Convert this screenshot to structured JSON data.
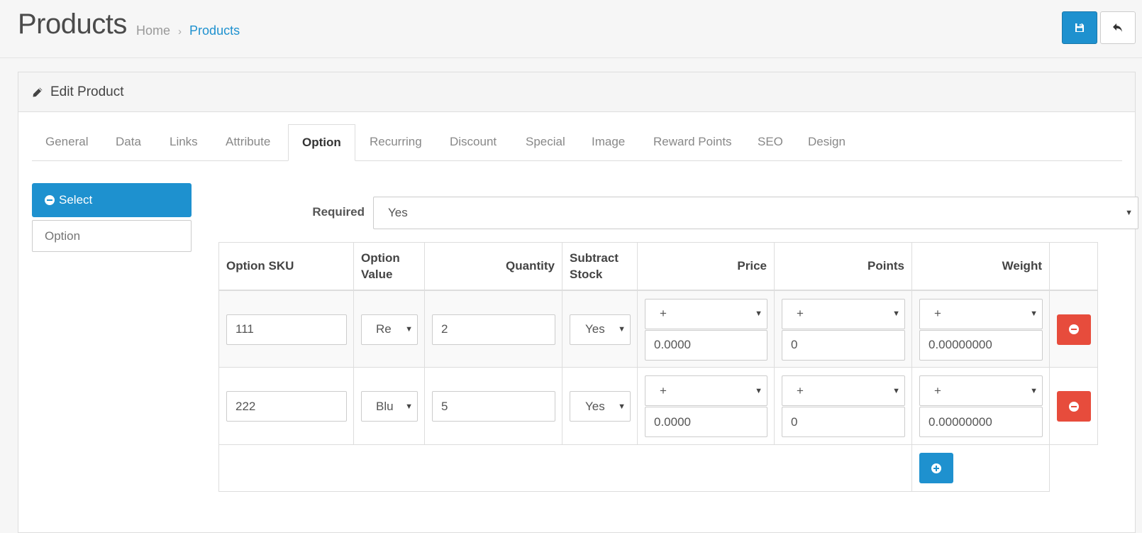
{
  "header": {
    "title": "Products",
    "breadcrumb": [
      {
        "label": "Home"
      },
      {
        "label": "Products"
      }
    ],
    "breadcrumb_separator": "›",
    "save_icon": "floppy-disk-icon",
    "back_icon": "reply-icon"
  },
  "panel": {
    "title": "Edit Product",
    "title_icon": "pencil-icon"
  },
  "tabs": [
    {
      "label": "General"
    },
    {
      "label": "Data"
    },
    {
      "label": "Links"
    },
    {
      "label": "Attribute"
    },
    {
      "label": "Option",
      "active": true
    },
    {
      "label": "Recurring"
    },
    {
      "label": "Discount"
    },
    {
      "label": "Special"
    },
    {
      "label": "Image"
    },
    {
      "label": "Reward Points"
    },
    {
      "label": "SEO"
    },
    {
      "label": "Design"
    }
  ],
  "option_sidebar": {
    "selected_option": "Select",
    "option_input_placeholder": "Option"
  },
  "required": {
    "label": "Required",
    "value": "Yes"
  },
  "table": {
    "headers": {
      "sku": "Option SKU",
      "value_line1": "Option",
      "value_line2": "Value",
      "quantity": "Quantity",
      "subtract_line1": "Subtract",
      "subtract_line2": "Stock",
      "price": "Price",
      "points": "Points",
      "weight": "Weight"
    },
    "rows": [
      {
        "sku": "111",
        "option_value": "Re",
        "quantity": "2",
        "subtract": "Yes",
        "price_prefix": "+",
        "price": "0.0000",
        "points_prefix": "+",
        "points": "0",
        "weight_prefix": "+",
        "weight": "0.00000000"
      },
      {
        "sku": "222",
        "option_value": "Blu",
        "quantity": "5",
        "subtract": "Yes",
        "price_prefix": "+",
        "price": "0.0000",
        "points_prefix": "+",
        "points": "0",
        "weight_prefix": "+",
        "weight": "0.00000000"
      }
    ]
  },
  "colors": {
    "primary": "#1e91cf",
    "danger": "#e74c3c"
  }
}
